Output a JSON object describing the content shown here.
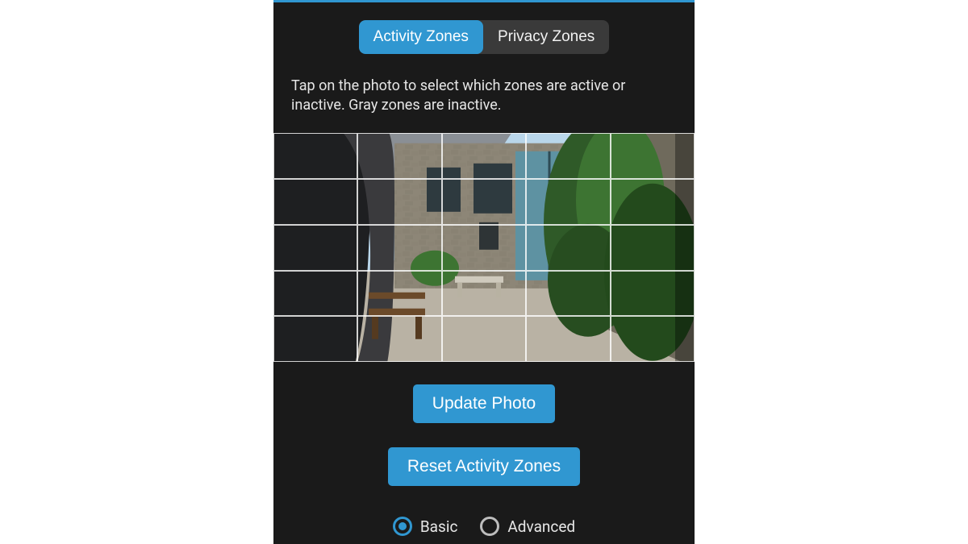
{
  "tabs": {
    "activity": "Activity Zones",
    "privacy": "Privacy Zones",
    "active": "activity"
  },
  "instructions": "Tap on the photo to select which zones are active or inactive. Gray zones are inactive.",
  "grid": {
    "rows": 5,
    "cols": 5
  },
  "buttons": {
    "update_photo": "Update Photo",
    "reset_zones": "Reset Activity Zones"
  },
  "mode": {
    "basic_label": "Basic",
    "advanced_label": "Advanced",
    "selected": "basic"
  },
  "colors": {
    "accent": "#3097d1",
    "panel_bg": "#1a1a1a",
    "segmented_bg": "#3a3a3a",
    "text": "#e6e6e6"
  }
}
